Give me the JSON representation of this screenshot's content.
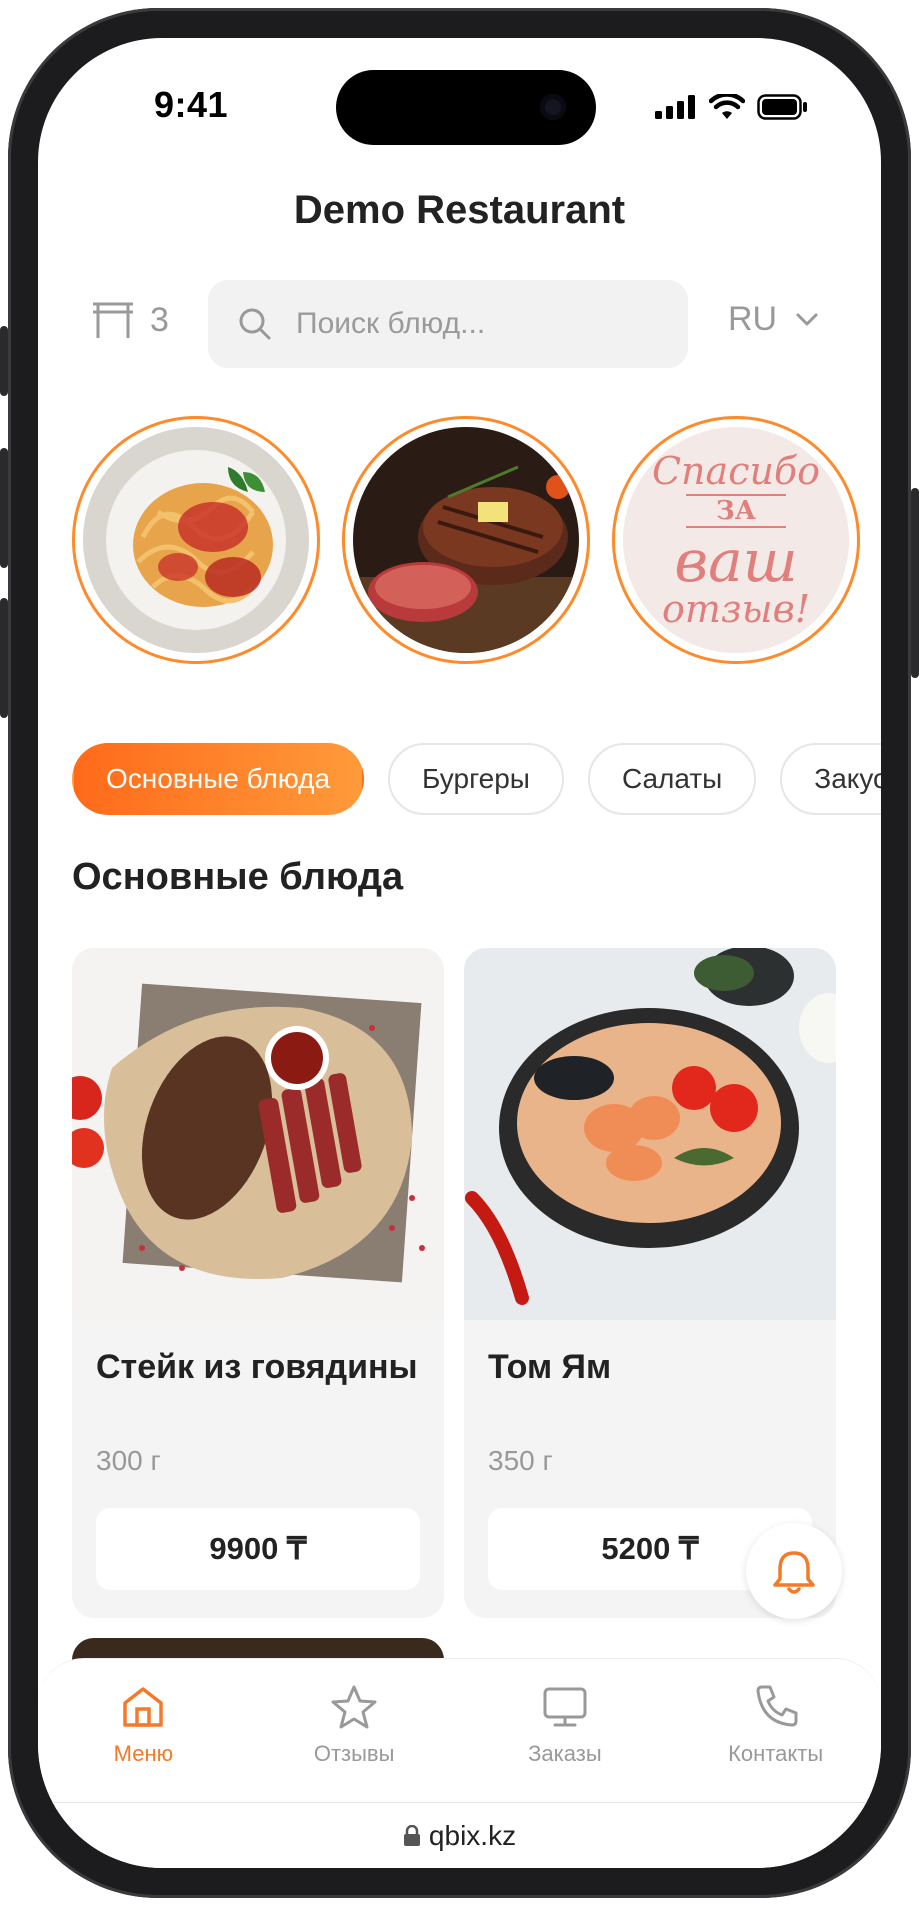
{
  "status": {
    "time": "9:41"
  },
  "header": {
    "title": "Demo Restaurant"
  },
  "toolbar": {
    "table_number": "3",
    "search_placeholder": "Поиск блюд...",
    "language": "RU"
  },
  "stories": [
    {
      "name": "spaghetti-story",
      "alt": "Спагетти"
    },
    {
      "name": "steak-story",
      "alt": "Стейк"
    },
    {
      "name": "feedback-story",
      "line1": "Спасибо",
      "line2": "ЗА",
      "line3": "ваш",
      "line4": "отзыв!"
    }
  ],
  "categories": [
    {
      "label": "Основные блюда",
      "active": true
    },
    {
      "label": "Бургеры",
      "active": false
    },
    {
      "label": "Салаты",
      "active": false
    },
    {
      "label": "Закуски",
      "active": false
    }
  ],
  "section": {
    "title": "Основные блюда"
  },
  "dishes": [
    {
      "name": "Стейк из говядины",
      "weight": "300 г",
      "price": "9900 ₸"
    },
    {
      "name": "Том Ям",
      "weight": "350 г",
      "price": "5200 ₸"
    }
  ],
  "tabs": [
    {
      "label": "Меню",
      "icon": "home-icon",
      "active": true
    },
    {
      "label": "Отзывы",
      "icon": "star-icon",
      "active": false
    },
    {
      "label": "Заказы",
      "icon": "monitor-icon",
      "active": false
    },
    {
      "label": "Контакты",
      "icon": "phone-icon",
      "active": false
    }
  ],
  "browser": {
    "url": "qbix.kz"
  },
  "colors": {
    "accent": "#f47a2a",
    "accent_light": "#ff9a3a",
    "chip_border": "#e6e6e6",
    "card_bg": "#f4f4f4"
  }
}
